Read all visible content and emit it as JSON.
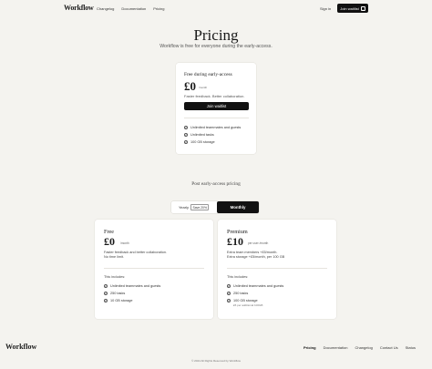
{
  "header": {
    "logo": "Workflow",
    "nav": [
      "Changelog",
      "Documentation",
      "Pricing"
    ],
    "sign_in": "Sign in",
    "join_waitlist": "Join waitlist"
  },
  "hero": {
    "title": "Pricing",
    "subtitle": "Workflow is free for everyone during the early-access."
  },
  "early_access": {
    "title": "Free during early-access",
    "price": "£0",
    "per": "/month",
    "tagline": "Faster feedback. Better collaboration.",
    "button": "Join waitlist",
    "features": [
      "Unlimited teammates and guests",
      "Unlimited tasks",
      "100 GB storage"
    ]
  },
  "post_access": {
    "heading": "Post early-access pricing",
    "toggle": {
      "yearly": "Yearly",
      "save": "Save 20%",
      "monthly": "Monthly",
      "selected": "Monthly"
    }
  },
  "plans": [
    {
      "name": "Free",
      "price": "£0",
      "per": "/month",
      "desc1": "Faster feedback and better collaboration.",
      "desc2": "No time limit.",
      "includes": "This includes:",
      "features": [
        "Unlimited teammates and guests",
        "250 tasks",
        "10 GB storage"
      ],
      "note": ""
    },
    {
      "name": "Premium",
      "price": "£10",
      "per": "per user /month",
      "desc1": "Extra team members +£5/month.",
      "desc2": "Extra storage +£5/month, per 100 GB",
      "includes": "This includes:",
      "features": [
        "Unlimited teammates and guests",
        "250 tasks",
        "100 GB storage"
      ],
      "note": "£5 per additional 100GB"
    }
  ],
  "footer": {
    "logo": "Workflow",
    "nav": [
      "Pricing",
      "Documentation",
      "Changelog",
      "Contact Us",
      "Status"
    ],
    "active": "Pricing",
    "copyright": "© 2024 All Rights Reserved by Workflow"
  },
  "colors": {
    "background": "#f4f3ef",
    "primary": "#111111",
    "card": "#ffffff"
  },
  "icons": {
    "check": "check-circle-icon",
    "arrow": "arrow-right-icon"
  }
}
